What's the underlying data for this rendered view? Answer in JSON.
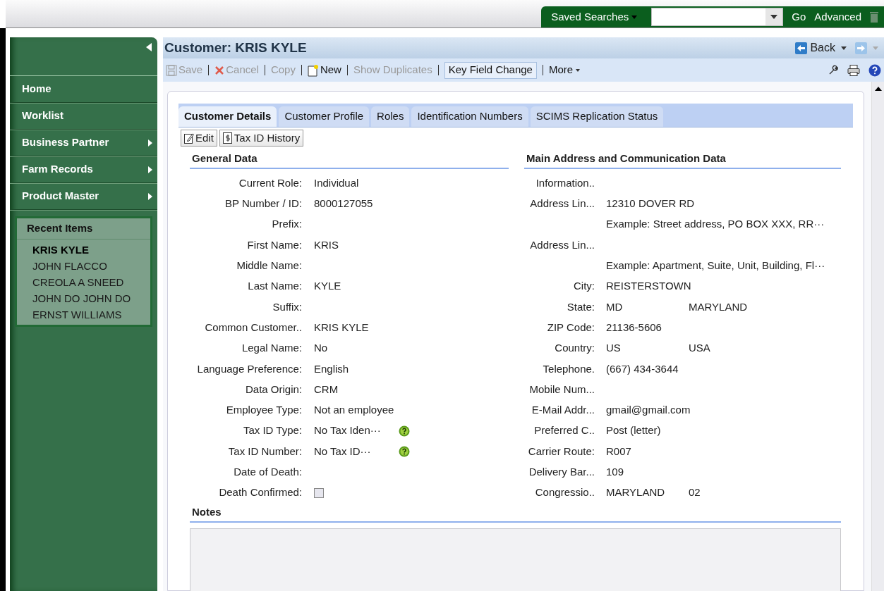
{
  "header": {
    "saved_searches": "Saved Searches",
    "go": "Go",
    "advanced": "Advanced"
  },
  "sidebar": {
    "items": [
      {
        "label": "Home",
        "submenu": false
      },
      {
        "label": "Worklist",
        "submenu": false
      },
      {
        "label": "Business Partner",
        "submenu": true
      },
      {
        "label": "Farm Records",
        "submenu": true
      },
      {
        "label": "Product Master",
        "submenu": true
      }
    ],
    "recent": {
      "title": "Recent Items",
      "items": [
        {
          "label": "KRIS KYLE",
          "selected": true
        },
        {
          "label": "JOHN FLACCO",
          "selected": false
        },
        {
          "label": "CREOLA A SNEED",
          "selected": false
        },
        {
          "label": "JOHN DO JOHN DO",
          "selected": false
        },
        {
          "label": "ERNST WILLIAMS",
          "selected": false
        }
      ]
    }
  },
  "page": {
    "title": "Customer: KRIS KYLE",
    "back": "Back"
  },
  "toolbar": [
    {
      "label": "Save",
      "kind": "save",
      "disabled": true
    },
    {
      "label": "Cancel",
      "kind": "cancel",
      "disabled": true
    },
    {
      "label": "Copy",
      "kind": "plain",
      "disabled": true
    },
    {
      "label": "New",
      "kind": "new",
      "disabled": false
    },
    {
      "label": "Show Duplicates",
      "kind": "plain",
      "disabled": true
    },
    {
      "label": "Key Field Change",
      "kind": "boxed",
      "disabled": false
    },
    {
      "label": "More",
      "kind": "menu",
      "disabled": false
    }
  ],
  "tabs": [
    {
      "label": "Customer Details",
      "selected": true
    },
    {
      "label": "Customer Profile",
      "selected": false
    },
    {
      "label": "Roles",
      "selected": false
    },
    {
      "label": "Identification Numbers",
      "selected": false
    },
    {
      "label": "SCIMS Replication Status",
      "selected": false
    }
  ],
  "actions": [
    {
      "label": "Edit",
      "kind": "edit"
    },
    {
      "label": "Tax ID History",
      "kind": "history"
    }
  ],
  "general": {
    "title": "General Data",
    "rows": [
      {
        "label": "Current Role:",
        "value": "Individual",
        "kind": "text"
      },
      {
        "label": "BP Number / ID:",
        "value": "8000127055",
        "kind": "text"
      },
      {
        "label": "Prefix:",
        "kind": "text"
      },
      {
        "label": "First Name:",
        "value": "KRIS",
        "kind": "text"
      },
      {
        "label": "Middle Name:",
        "kind": "text"
      },
      {
        "label": "Last Name:",
        "value": "KYLE",
        "kind": "text"
      },
      {
        "label": "Suffix:",
        "kind": "text"
      },
      {
        "label": "Common Customer..",
        "value": "KRIS KYLE",
        "kind": "text"
      },
      {
        "label": "Legal Name:",
        "value": "No",
        "kind": "text"
      },
      {
        "label": "Language Preference:",
        "value": "English",
        "kind": "text"
      },
      {
        "label": "Data Origin:",
        "value": "CRM",
        "kind": "text"
      },
      {
        "label": "Employee Type:",
        "value": "Not an employee",
        "kind": "text"
      },
      {
        "label": "Tax ID Type:",
        "value": "No Tax Iden···",
        "kind": "help"
      },
      {
        "label": "Tax ID Number:",
        "value": "No Tax ID···",
        "kind": "help"
      },
      {
        "label": "Date of Death:",
        "kind": "text"
      },
      {
        "label": "Death Confirmed:",
        "kind": "checkbox",
        "checked": false
      }
    ]
  },
  "address": {
    "title": "Main Address and Communication Data",
    "rows": [
      {
        "label": "Information.."
      },
      {
        "label": "Address Lin...",
        "value": "12310 DOVER RD"
      },
      {
        "value": "Example: Street address, PO BOX XXX, RR···"
      },
      {
        "label": "Address Lin..."
      },
      {
        "value": "Example: Apartment, Suite, Unit, Building, Fl···"
      },
      {
        "label": "City:",
        "value": "REISTERSTOWN"
      },
      {
        "label": "State:",
        "value": "MD",
        "value2": "MARYLAND"
      },
      {
        "label": "ZIP Code:",
        "value": "21136-5606"
      },
      {
        "label": "Country:",
        "value": "US",
        "value2": "USA"
      },
      {
        "label": "Telephone.",
        "value": "(667) 434-3644"
      },
      {
        "label": "Mobile Num..."
      },
      {
        "label": "E-Mail Addr...",
        "value": "gmail@gmail.com"
      },
      {
        "label": "Preferred C..",
        "value": "Post (letter)"
      },
      {
        "label": "Carrier Route:",
        "value": "R007"
      },
      {
        "label": "Delivery Bar...",
        "value": "109"
      },
      {
        "label": "Congressio..",
        "value": "MARYLAND",
        "value2": "02"
      }
    ]
  },
  "notes": {
    "title": "Notes"
  }
}
